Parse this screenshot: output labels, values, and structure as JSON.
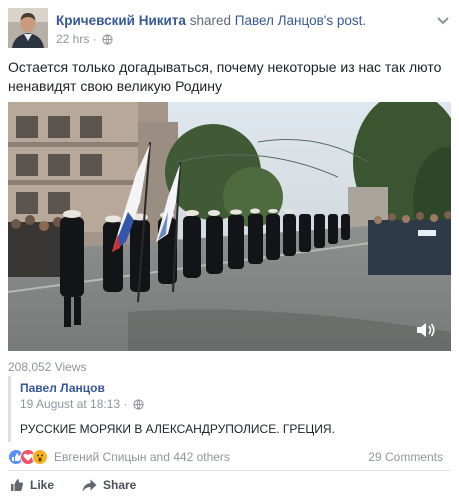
{
  "post": {
    "author": "Кричевский Никита",
    "shared_word": "shared",
    "original_author_possessive": "Павел Ланцов's",
    "post_word": "post.",
    "time": "22 hrs",
    "separator": "·",
    "text": "Остается только догадываться, почему некоторые из нас так люто ненавидят свою великую Родину"
  },
  "video": {
    "views": "208,052 Views",
    "icons": [
      "volume-icon"
    ]
  },
  "shared_post": {
    "author": "Павел Ланцов",
    "date": "19 August at 18:13",
    "separator": "·",
    "text": "РУССКИЕ МОРЯКИ В АЛЕКСАНДРУПОЛИСЕ. ГРЕЦИЯ."
  },
  "reactions": {
    "names": "Евгений Спицын and 442 others",
    "comments": "29 Comments",
    "colors": {
      "like": "#5890ff",
      "love": "#f25268",
      "wow": "#f7b125"
    }
  },
  "actions": {
    "like": "Like",
    "share": "Share"
  },
  "colors": {
    "link": "#365899",
    "muted": "#90949c",
    "text": "#1d2129"
  }
}
